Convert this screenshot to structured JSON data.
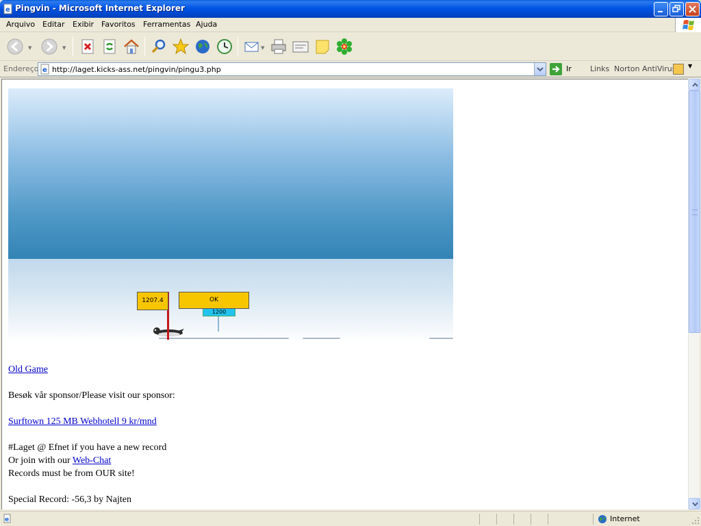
{
  "window": {
    "title": "Pingvin - Microsoft Internet Explorer"
  },
  "menu": [
    "Arquivo",
    "Editar",
    "Exibir",
    "Favoritos",
    "Ferramentas",
    "Ajuda"
  ],
  "address": {
    "label": "Endereço",
    "url": "http://laget.kicks-ass.net/pingvin/pingu3.php",
    "go_label": "Ir",
    "links_label": "Links",
    "norton_label": "Norton AntiVirus"
  },
  "game": {
    "distance": "1207.4",
    "ok_label": "OK",
    "target": "1200"
  },
  "content": {
    "old_game_link": "Old Game",
    "sponsor_text": "Besøk vår sponsor/Please visit our sponsor:",
    "sponsor_link": "Surftown 125 MB Webhotell 9 kr/mnd",
    "record_text": "#Laget @ Efnet if you have a new record",
    "join_prefix": "Or join with our ",
    "webchat_link": "Web-Chat",
    "records_note": "Records must be from OUR site!",
    "special_record": "Special Record: -56,3 by Najten"
  },
  "status": {
    "zone": "Internet"
  }
}
